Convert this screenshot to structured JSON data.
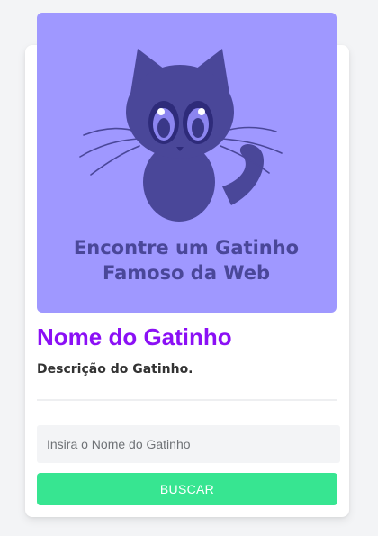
{
  "theme": {
    "accent_purple": "#8b10f5",
    "button_green": "#37e591",
    "banner_background": "#9f98ff",
    "cat_color": "#4a4799"
  },
  "banner": {
    "icon": "cat-icon",
    "caption_line1": "Encontre um Gatinho",
    "caption_line2": "Famoso da Web"
  },
  "cat": {
    "name": "Nome do Gatinho",
    "description": "Descrição do Gatinho."
  },
  "search": {
    "placeholder": "Insira o Nome do Gatinho",
    "value": "",
    "button_label": "BUSCAR"
  }
}
